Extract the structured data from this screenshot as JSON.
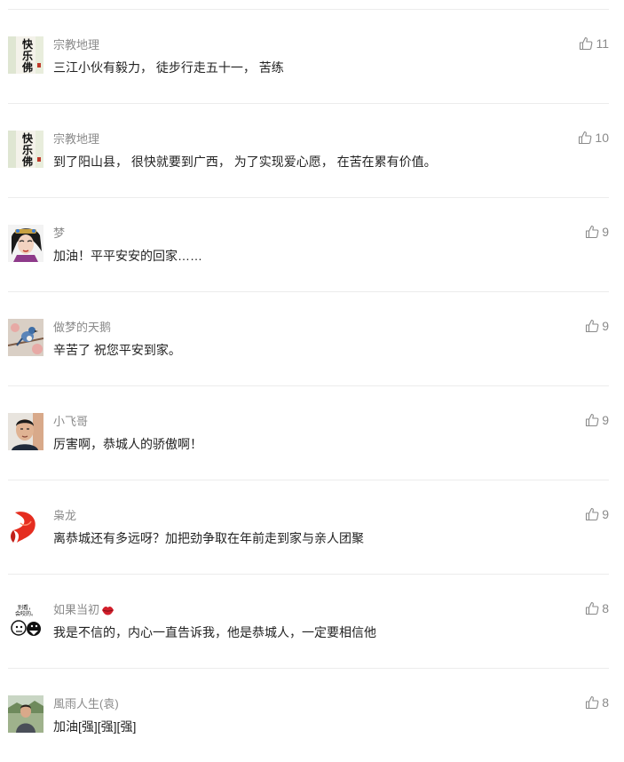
{
  "comments": [
    {
      "username": "宗教地理",
      "text": "三江小伙有毅力， 徒步行走五十一， 苦练",
      "likes": "11",
      "avatar": "kuaile-fo-calligraphy"
    },
    {
      "username": "宗教地理",
      "text": "到了阳山县， 很快就要到广西， 为了实现爱心愿， 在苦在累有价值。",
      "likes": "10",
      "avatar": "kuaile-fo-calligraphy"
    },
    {
      "username": "梦",
      "text": "加油！平平安安的回家……",
      "likes": "9",
      "avatar": "opera-woman"
    },
    {
      "username": "做梦的天鹅",
      "text": "辛苦了 祝您平安到家。",
      "likes": "9",
      "avatar": "bird-on-branch"
    },
    {
      "username": "小飞哥",
      "text": "厉害啊，恭城人的骄傲啊！",
      "likes": "9",
      "avatar": "man-portrait"
    },
    {
      "username": "枭龙",
      "text": "离恭城还有多远呀？加把劲争取在年前走到家与亲人团聚",
      "likes": "9",
      "avatar": "red-koi"
    },
    {
      "username": "如果当初",
      "text": "我是不信的，内心一直告诉我，他是恭城人，一定要相信他",
      "likes": "8",
      "avatar": "cartoon-comic",
      "badge": "lips-icon"
    },
    {
      "username": "風雨人生(袁)",
      "text": "加油[强][强][强]",
      "likes": "8",
      "avatar": "outdoor-man"
    }
  ],
  "avatar_text": {
    "calligraphy": [
      "快",
      "乐",
      "佛"
    ],
    "comic": [
      "别看，",
      "会咬的。"
    ]
  },
  "colors": {
    "username": "#8a8a8a",
    "text": "#222222",
    "divider": "#ececec",
    "like_icon": "#8a8a8a"
  }
}
